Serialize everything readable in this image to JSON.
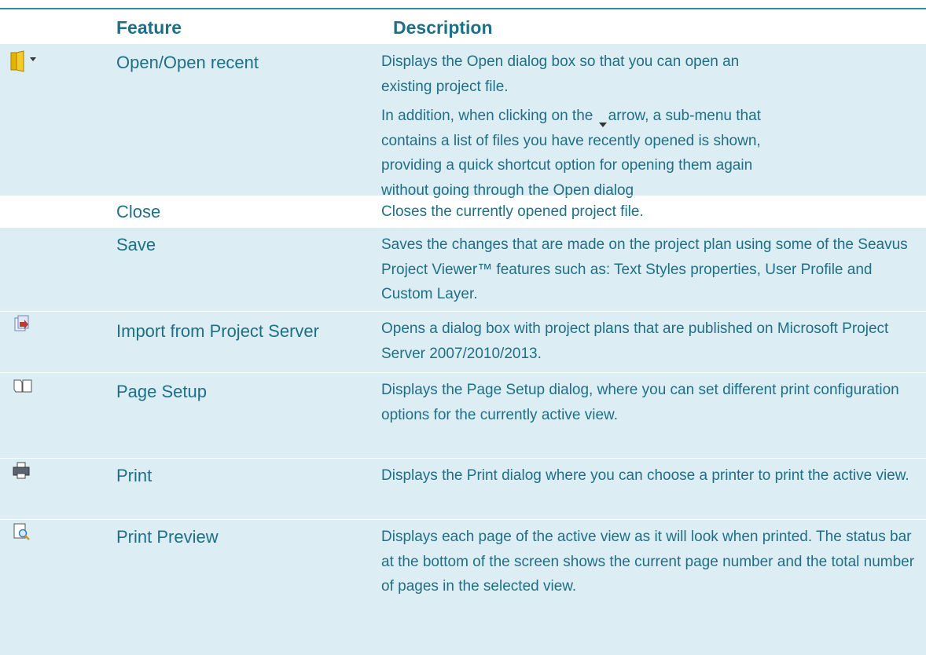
{
  "table": {
    "headers": {
      "feature": "Feature",
      "description": "Description"
    },
    "rows": [
      {
        "icon": "open-folder-dropdown-icon",
        "feature": "Open/Open recent",
        "desc": [
          "Displays the Open dialog box so that you can open an existing project file.",
          "In addition, when clicking on the",
          "arrow, a sub-menu that contains a list of files you have recently opened is shown, providing a quick shortcut option for opening them again without going through the Open dialog"
        ]
      },
      {
        "icon": "",
        "feature": "Close",
        "desc": [
          "Closes the currently opened project file."
        ]
      },
      {
        "icon": "",
        "feature": "Save",
        "desc": [
          "Saves the changes that are made on the project plan using some of the Seavus Project Viewer™ features such as: Text Styles properties, User Profile and Custom Layer."
        ]
      },
      {
        "icon": "import-server-icon",
        "feature": "Import from Project Server",
        "desc": [
          "Opens a dialog box with project plans that are published on Microsoft Project Server 2007/2010/2013."
        ]
      },
      {
        "icon": "page-setup-icon",
        "feature": "Page Setup",
        "desc": [
          "Displays the Page Setup dialog, where you can set different print configuration options for the currently active view."
        ]
      },
      {
        "icon": "printer-icon",
        "feature": "Print",
        "desc": [
          "Displays the Print dialog where you can choose a printer to print the active view."
        ]
      },
      {
        "icon": "print-preview-icon",
        "feature": "Print Preview",
        "desc": [
          "Displays each page of the active view as it will look when printed. The status bar at the bottom of the screen shows the current page number and the total number of pages in the selected view."
        ]
      }
    ]
  },
  "colors": {
    "accent": "#1f6f86",
    "row_shade": "#dcedf4",
    "rule": "#2f8fa0"
  }
}
